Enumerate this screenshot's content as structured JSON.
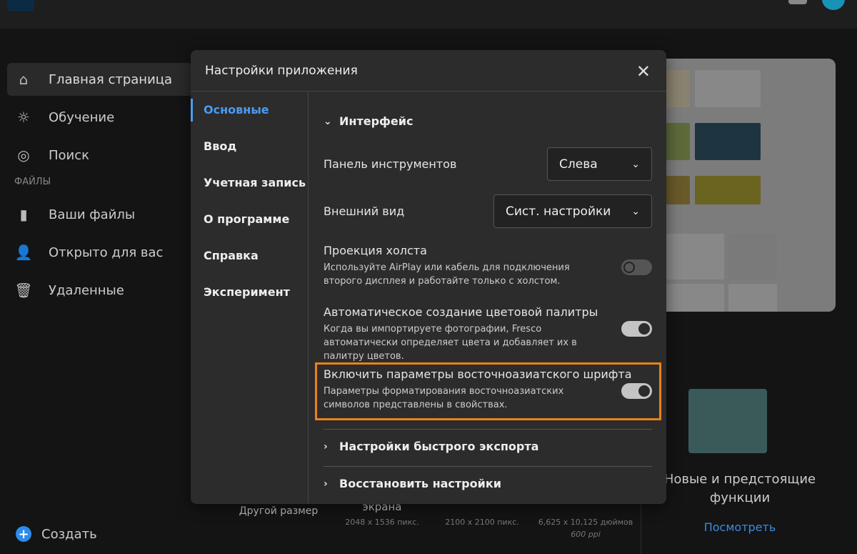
{
  "sidebar": {
    "items": [
      {
        "label": "Главная страница",
        "icon": "home-icon"
      },
      {
        "label": "Обучение",
        "icon": "lightbulb-icon"
      },
      {
        "label": "Поиск",
        "icon": "compass-icon"
      }
    ],
    "section": "ФАЙЛЫ",
    "files": [
      {
        "label": "Ваши файлы",
        "icon": "file-icon"
      },
      {
        "label": "Открыто для вас",
        "icon": "users-icon"
      },
      {
        "label": "Удаленные",
        "icon": "trash-icon"
      }
    ],
    "create": "Создать"
  },
  "background": {
    "presets": [
      {
        "name": "Другой размер",
        "size": ""
      },
      {
        "name": "экрана",
        "size": "2048 x 1536 пикс."
      },
      {
        "name": "",
        "size": "2100 x 2100 пикс."
      },
      {
        "name": "",
        "size": "6,625 x 10,125 дюймов",
        "extra": "600 ppi"
      }
    ],
    "promo": {
      "title": "Новые и предстоящие функции",
      "link": "Посмотреть"
    }
  },
  "modal": {
    "title": "Настройки приложения",
    "nav": [
      "Основные",
      "Ввод",
      "Учетная запись",
      "О программе",
      "Справка",
      "Эксперимент"
    ],
    "section_interface": "Интерфейс",
    "toolbar": {
      "label": "Панель инструментов",
      "value": "Слева"
    },
    "appearance": {
      "label": "Внешний вид",
      "value": "Сист. настройки"
    },
    "projection": {
      "label": "Проекция холста",
      "desc": "Используйте AirPlay или кабель для подключения второго дисплея и работайте только с холстом.",
      "enabled": false
    },
    "palette": {
      "label": "Автоматическое создание цветовой палитры",
      "desc": "Когда вы импортируете фотографии, Fresco автоматически определяет цвета и добавляет их в палитру цветов.",
      "enabled": true
    },
    "eastasian": {
      "label": "Включить параметры восточноазиатского шрифта",
      "desc": "Параметры форматирования восточноазиатских символов представлены в свойствах.",
      "enabled": true
    },
    "quick_export": "Настройки быстрого экспорта",
    "restore": "Восстановить настройки"
  },
  "colors": {
    "accent": "#4a9cf0",
    "highlight": "#e8821a"
  }
}
